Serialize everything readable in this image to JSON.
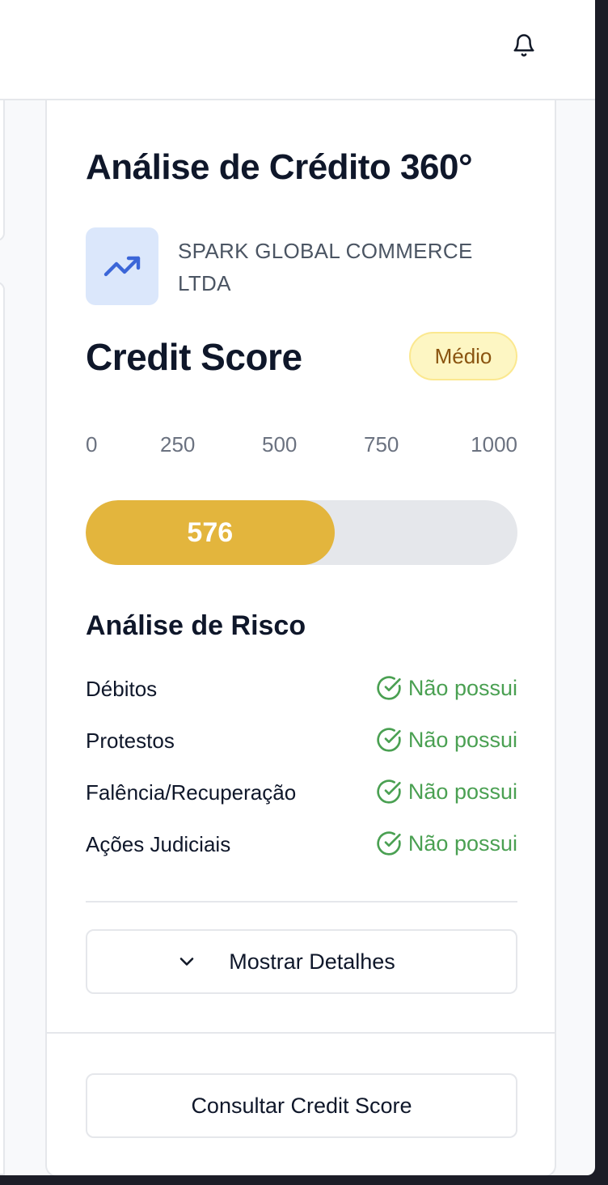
{
  "header": {
    "bell_icon": "bell-icon"
  },
  "card": {
    "title": "Análise de Crédito 360°",
    "company": {
      "icon": "trending-up-icon",
      "name": "SPARK GLOBAL COMMERCE LTDA"
    },
    "score": {
      "title": "Credit Score",
      "badge": "Médio",
      "scale_labels": [
        "0",
        "250",
        "500",
        "750",
        "1000"
      ],
      "value": 576,
      "value_label": "576",
      "min": 0,
      "max": 1000,
      "colors": {
        "fill": "#e3b53d",
        "track": "#e5e7eb"
      }
    },
    "risk": {
      "title": "Análise de Risco",
      "items": [
        {
          "label": "Débitos",
          "status": "Não possui"
        },
        {
          "label": "Protestos",
          "status": "Não possui"
        },
        {
          "label": "Falência/Recuperação",
          "status": "Não possui"
        },
        {
          "label": "Ações Judiciais",
          "status": "Não possui"
        }
      ],
      "status_color": "#4aa052"
    },
    "details_button": "Mostrar Detalhes",
    "consult_button": "Consultar Credit Score"
  }
}
